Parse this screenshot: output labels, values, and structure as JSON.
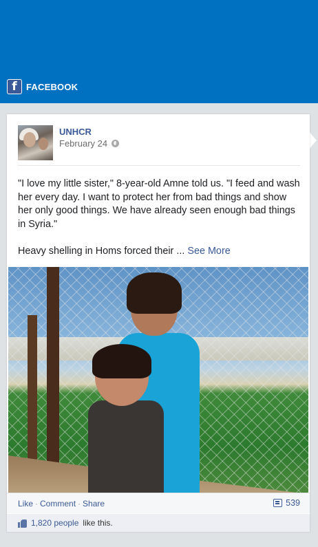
{
  "header": {
    "brand_logo_glyph": "f",
    "brand_label": "FACEBOOK",
    "background_color": "#0070c0"
  },
  "post": {
    "author": "UNHCR",
    "date": "February 24",
    "privacy_icon": "globe-icon",
    "text_paragraph_1": "\"I love my little sister,\" 8-year-old Amne told us. \"I feed and wash her every day. I want to protect her from bad things and show her only good things. We have already seen enough bad things in Syria.\"",
    "text_paragraph_2": "Heavy shelling in Homs forced their ...",
    "see_more_label": "See More",
    "photo_description_icon": "photo-two-girls-hugging"
  },
  "actions": {
    "like_label": "Like",
    "comment_label": "Comment",
    "share_label": "Share",
    "separator": "·",
    "comment_count": "539"
  },
  "likes": {
    "count_label": "1,820 people",
    "suffix": "like this."
  },
  "colors": {
    "link": "#3b5998",
    "card_bg": "#ffffff",
    "page_bg": "#dfe2e5"
  }
}
